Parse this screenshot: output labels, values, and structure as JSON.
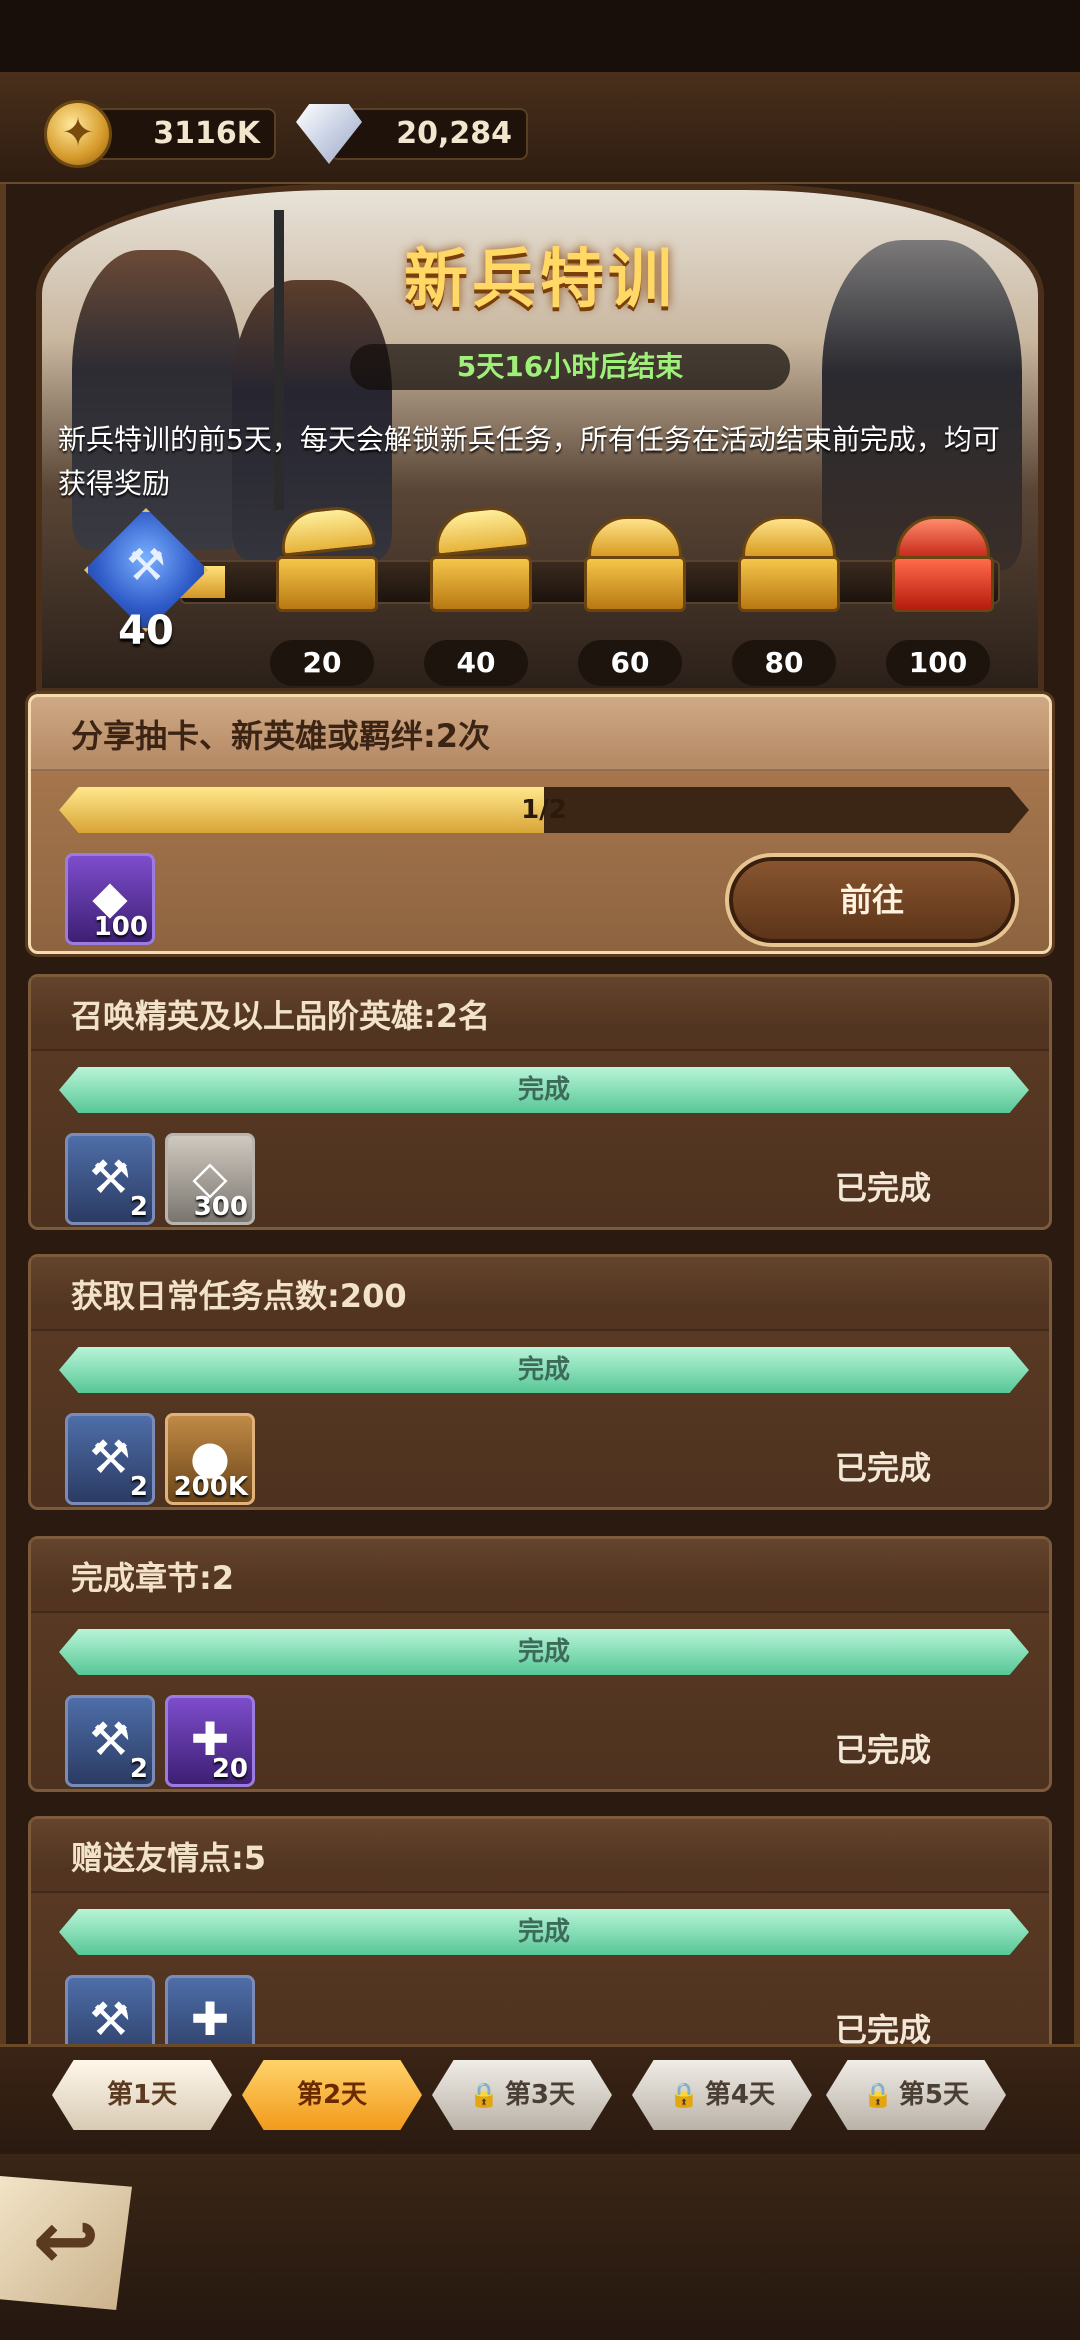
{
  "resources": {
    "gold": "3116K",
    "gems": "20,284"
  },
  "event": {
    "title": "新兵特训",
    "timer": "5天16小时后结束",
    "description": "新兵特训的前5天，每天会解锁新兵任务，所有任务在活动结束前完成，均可获得奖励",
    "points": "40",
    "milestones": [
      "20",
      "40",
      "60",
      "80",
      "100"
    ]
  },
  "tasks": [
    {
      "title": "分享抽卡、新英雄或羁绊:2次",
      "progress_text": "1/2",
      "progress": 0.5,
      "action": "前往",
      "rewards": [
        {
          "icon": "purple-crystal-icon",
          "count": "100"
        }
      ]
    },
    {
      "title": "召唤精英及以上品阶英雄:2名",
      "progress_text": "完成",
      "progress": 1,
      "status": "已完成",
      "rewards": [
        {
          "icon": "rank-badge-icon",
          "count": "2"
        },
        {
          "icon": "diamond-icon",
          "count": "300"
        }
      ]
    },
    {
      "title": "获取日常任务点数:200",
      "progress_text": "完成",
      "progress": 1,
      "status": "已完成",
      "rewards": [
        {
          "icon": "rank-badge-icon",
          "count": "2"
        },
        {
          "icon": "gold-coin-icon",
          "count": "200K"
        }
      ]
    },
    {
      "title": "完成章节:2",
      "progress_text": "完成",
      "progress": 1,
      "status": "已完成",
      "rewards": [
        {
          "icon": "rank-badge-icon",
          "count": "2"
        },
        {
          "icon": "hero-shard-icon",
          "count": "20"
        }
      ]
    },
    {
      "title": "赠送友情点:5",
      "progress_text": "完成",
      "progress": 1,
      "status": "已完成",
      "rewards": [
        {
          "icon": "rank-badge-icon",
          "count": ""
        },
        {
          "icon": "hero-shard-icon",
          "count": ""
        }
      ]
    }
  ],
  "days": [
    "第1天",
    "第2天",
    "第3天",
    "第4天",
    "第5天"
  ],
  "active_day": "第2天"
}
